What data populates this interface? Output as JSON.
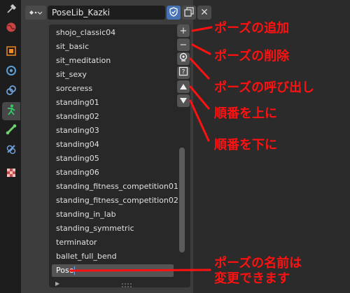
{
  "header": {
    "action_name": "PoseLib_Kazki"
  },
  "poses": [
    {
      "name": "shojo_classic04"
    },
    {
      "name": "sit_basic"
    },
    {
      "name": "sit_meditation"
    },
    {
      "name": "sit_sexy"
    },
    {
      "name": "sorceress"
    },
    {
      "name": "standing01"
    },
    {
      "name": "standing02"
    },
    {
      "name": "standing03"
    },
    {
      "name": "standing04"
    },
    {
      "name": "standing05"
    },
    {
      "name": "standing06"
    },
    {
      "name": "standing_fitness_competition01"
    },
    {
      "name": "standing_fitness_competition02"
    },
    {
      "name": "standing_in_lab"
    },
    {
      "name": "standing_symmetric"
    },
    {
      "name": "terminator"
    },
    {
      "name": "ballet_full_bend"
    }
  ],
  "editing_value": "Pose",
  "side_buttons": {
    "add": "+",
    "remove": "−"
  },
  "annotations": {
    "add": "ポーズの追加",
    "remove": "ポーズの削除",
    "apply": "ポーズの呼び出し",
    "move_up": "順番を上に",
    "move_down": "順番を下に",
    "rename_line1": "ポーズの名前は",
    "rename_line2": "変更できます"
  },
  "colors": {
    "annotation": "#ff1111",
    "accent_blue": "#4772b3",
    "active_tab_icon": "#33cc66"
  }
}
